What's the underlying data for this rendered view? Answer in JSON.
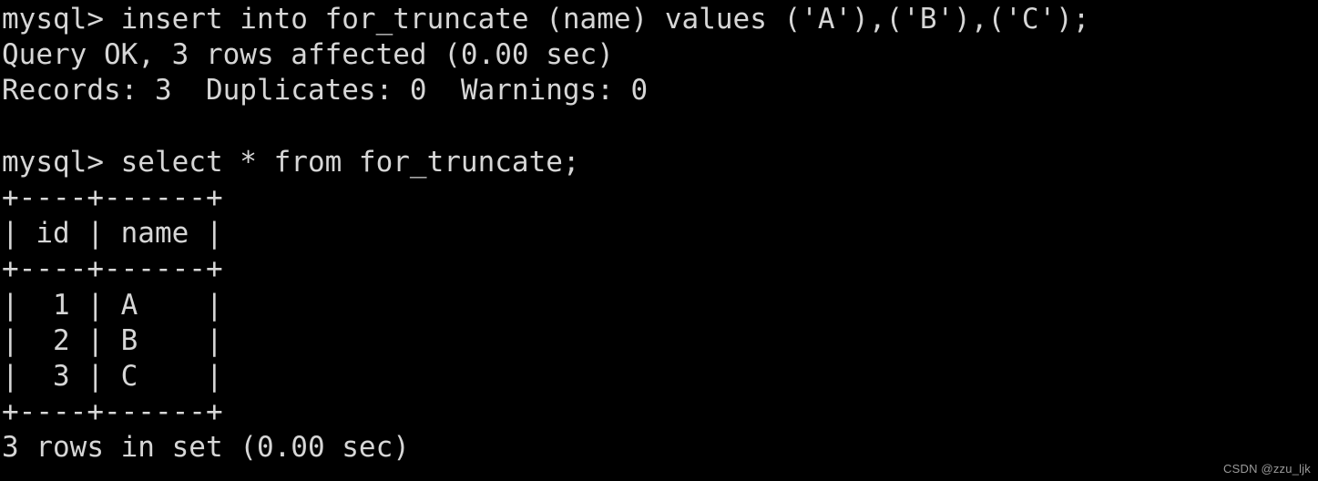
{
  "terminal": {
    "background_color": "#000000",
    "text_color": "#d6d6d6",
    "prompt": "mysql>",
    "lines": [
      "mysql> insert into for_truncate (name) values ('A'),('B'),('C');",
      "Query OK, 3 rows affected (0.00 sec)",
      "Records: 3  Duplicates: 0  Warnings: 0",
      "",
      "mysql> select * from for_truncate;",
      "+----+------+",
      "| id | name |",
      "+----+------+",
      "|  1 | A    |",
      "|  2 | B    |",
      "|  3 | C    |",
      "+----+------+",
      "3 rows in set (0.00 sec)"
    ],
    "commands": [
      "insert into for_truncate (name) values ('A'),('B'),('C');",
      "select * from for_truncate;"
    ],
    "status_messages": [
      "Query OK, 3 rows affected (0.00 sec)",
      "Records: 3  Duplicates: 0  Warnings: 0",
      "3 rows in set (0.00 sec)"
    ],
    "result_table": {
      "table_name": "for_truncate",
      "columns": [
        "id",
        "name"
      ],
      "rows": [
        [
          "1",
          "A"
        ],
        [
          "2",
          "B"
        ],
        [
          "3",
          "C"
        ]
      ],
      "row_count": "3 rows in set (0.00 sec)",
      "border": "+----+------+"
    }
  },
  "watermark": {
    "text": "CSDN @zzu_ljk",
    "color": "#9a9a9a"
  }
}
